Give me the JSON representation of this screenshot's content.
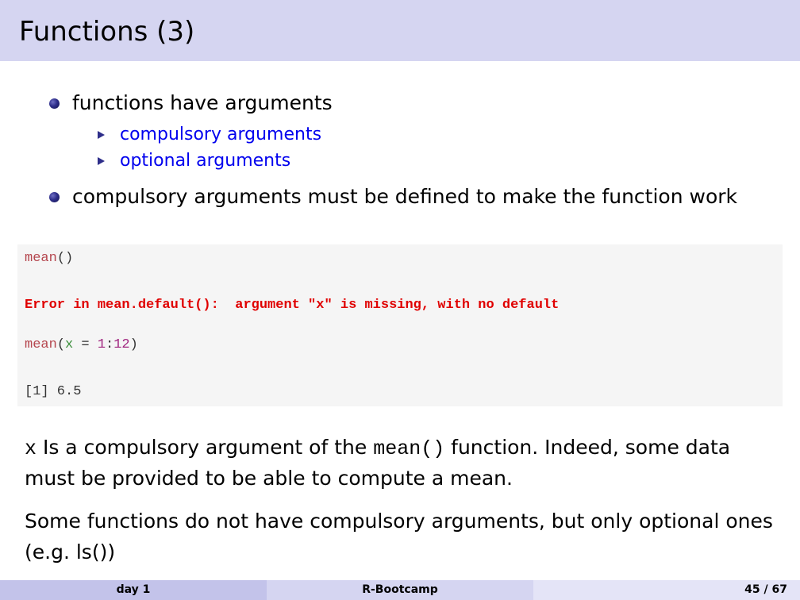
{
  "header": {
    "title": "Functions (3)"
  },
  "bullets": [
    {
      "text": "functions have arguments",
      "sub": [
        {
          "text": "compulsory arguments"
        },
        {
          "text": "optional arguments"
        }
      ]
    },
    {
      "text": "compulsory arguments must be defined to make the function work"
    }
  ],
  "code": {
    "line1_fn": "mean",
    "line1_rest": "()",
    "error": "Error in mean.default():  argument \"x\" is missing, with no default",
    "line3_fn": "mean",
    "line3_paren_open": "(",
    "line3_arg": "x",
    "line3_eq": " = ",
    "line3_num1": "1",
    "line3_colon": ":",
    "line3_num2": "12",
    "line3_paren_close": ")",
    "output": "[1] 6.5"
  },
  "para1": {
    "mono_start": "x",
    "text1": " Is a compulsory argument of the ",
    "mono_mid": "mean()",
    "text2": " function. Indeed, some data",
    "line2": "must be provided to be able to compute a mean."
  },
  "para2": {
    "line1": "Some functions do not have compulsory arguments, but only optional ones",
    "line2": "(e.g. ls())"
  },
  "footer": {
    "left": "day 1",
    "center": "R-Bootcamp",
    "right": "45 / 67"
  },
  "colors": {
    "header_bg": "#d5d5f1",
    "footer_left_bg": "#c3c3ea",
    "footer_center_bg": "#d5d5f1",
    "footer_right_bg": "#e4e4f7",
    "link_blue": "#0000ee",
    "error_red": "#e00000"
  }
}
